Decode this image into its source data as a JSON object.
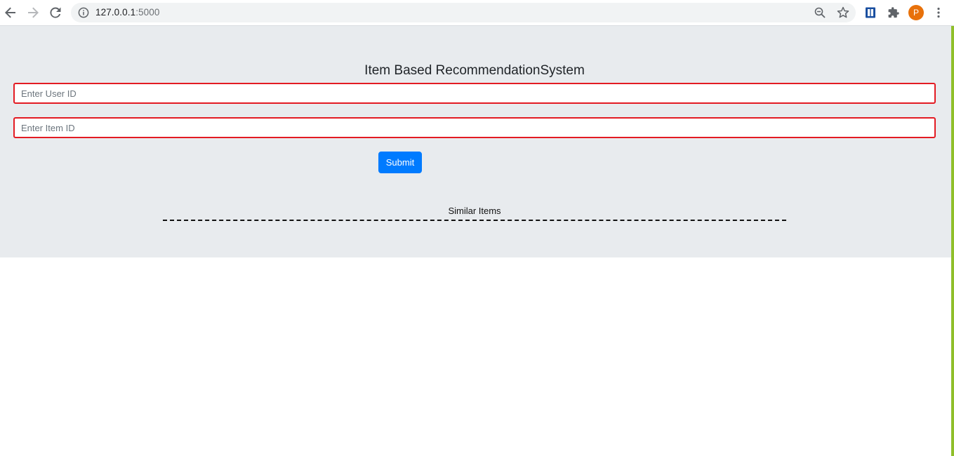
{
  "browser": {
    "url_host": "127.0.0.1",
    "url_port": ":5000",
    "avatar_letter": "P",
    "icons": {
      "back": "arrow-left-icon",
      "forward": "arrow-right-icon",
      "reload": "reload-icon",
      "site_info": "info-icon",
      "zoom": "zoom-out-icon",
      "bookmark": "star-icon",
      "extension_reader": "book-icon",
      "extensions": "puzzle-icon",
      "menu": "kebab-menu-icon"
    }
  },
  "page": {
    "title": "Item Based RecommendationSystem",
    "user_id_placeholder": "Enter User ID",
    "item_id_placeholder": "Enter Item ID",
    "user_id_value": "",
    "item_id_value": "",
    "submit_label": "Submit",
    "similar_items_label": "Similar Items"
  },
  "colors": {
    "panel_background": "#e8ebee",
    "input_border": "#e31b23",
    "submit_background": "#007bff",
    "avatar_background": "#e8710a",
    "right_edge": "#8fbf2a"
  }
}
